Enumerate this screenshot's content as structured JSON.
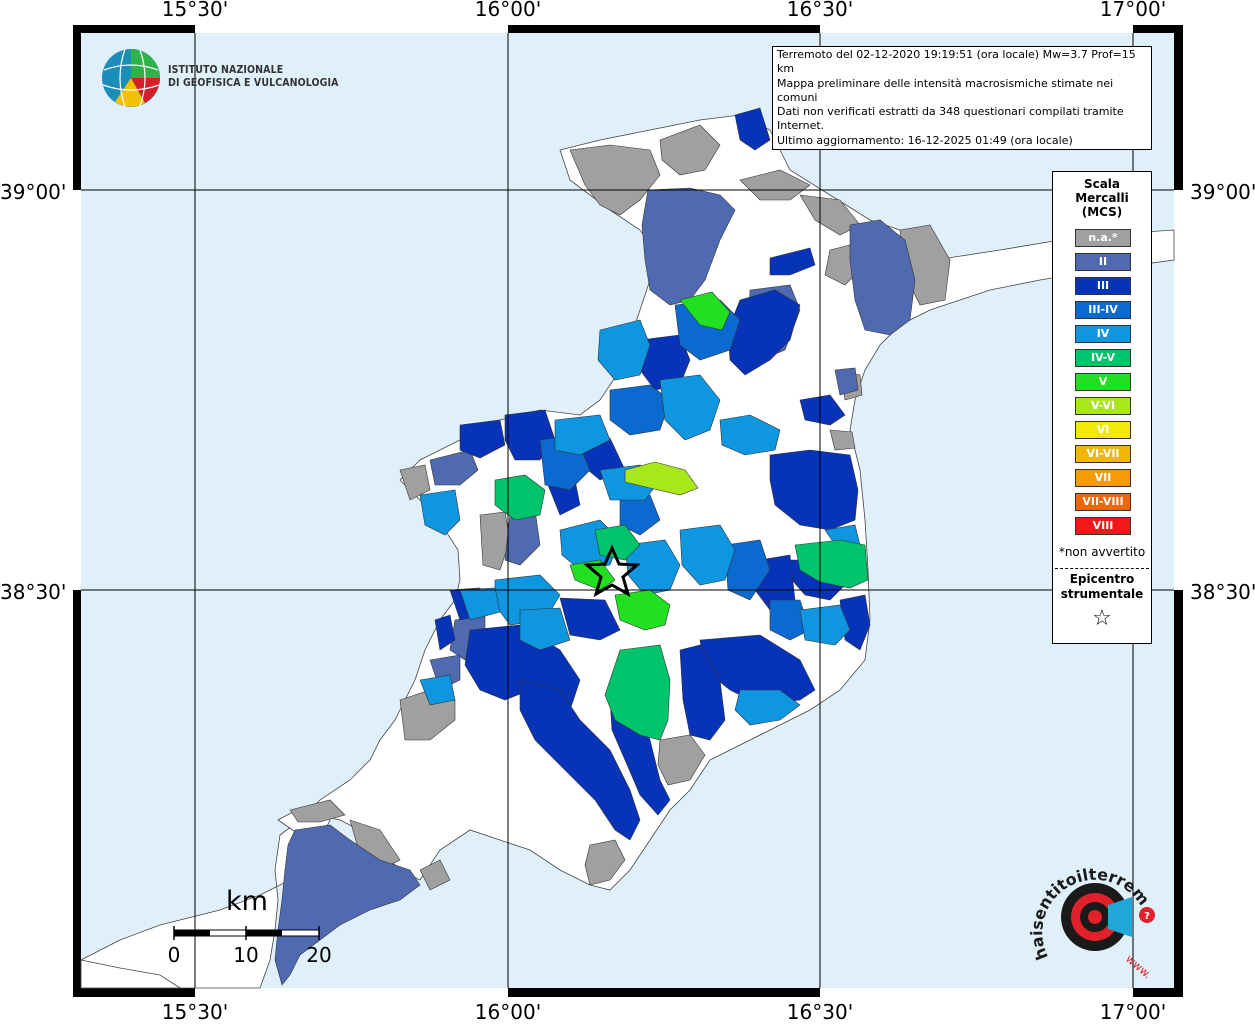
{
  "coords": {
    "lon_labels": [
      "15°30'",
      "16°00'",
      "16°30'",
      "17°00'"
    ],
    "lat_labels": [
      "39°00'",
      "38°30'"
    ]
  },
  "logo": {
    "line1": "ISTITUTO NAZIONALE",
    "line2": "DI GEOFISICA E VULCANOLOGIA"
  },
  "info": {
    "line1": "Terremoto del 02-12-2020 19:19:51 (ora locale) Mw=3.7 Prof=15 km",
    "line2": "Mappa preliminare delle intensità macrosismiche stimate nei comuni",
    "line3": "Dati non verificati estratti da 348 questionari compilati tramite Internet.",
    "line4": "Ultimo aggiornamento: 16-12-2025 01:49 (ora locale)"
  },
  "legend": {
    "title_line1": "Scala",
    "title_line2": "Mercalli",
    "title_line3": "(MCS)",
    "items": [
      {
        "label": "n.a.*",
        "color": "#a0a0a0"
      },
      {
        "label": "II",
        "color": "#4f6ab0"
      },
      {
        "label": "III",
        "color": "#0733b8"
      },
      {
        "label": "III-IV",
        "color": "#0a6ad0"
      },
      {
        "label": "IV",
        "color": "#0e97e0"
      },
      {
        "label": "IV-V",
        "color": "#00c46c"
      },
      {
        "label": "V",
        "color": "#20e020"
      },
      {
        "label": "V-VI",
        "color": "#a8e81a"
      },
      {
        "label": "VI",
        "color": "#f2e80a"
      },
      {
        "label": "VI-VII",
        "color": "#f2b60a"
      },
      {
        "label": "VII",
        "color": "#f79a0a"
      },
      {
        "label": "VII-VIII",
        "color": "#f2660a"
      },
      {
        "label": "VIII",
        "color": "#f01818"
      }
    ],
    "note": "*non avvertito",
    "epicenter_line1": "Epicentro",
    "epicenter_line2": "strumentale",
    "epicenter_symbol": "☆"
  },
  "scalebar": {
    "unit": "km",
    "labels": [
      "0",
      "10",
      "20"
    ]
  },
  "site_logo": {
    "text": "haisentitoilterremoto.it",
    "prefix": "www."
  },
  "colors": {
    "sea": "#dff0fb",
    "land": "#ffffff",
    "grid": "#000000"
  }
}
